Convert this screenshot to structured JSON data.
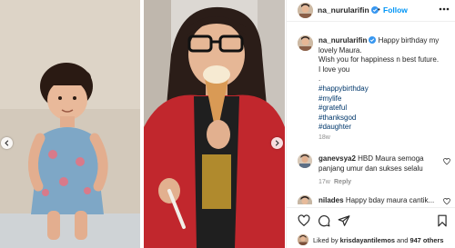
{
  "post": {
    "username": "na_nurularifin",
    "follow_label": "Follow",
    "separator": "•"
  },
  "caption": {
    "username": "na_nurularifin",
    "lines": [
      "Happy birthday my lovely Maura.",
      "Wish you for happiness n best future.",
      "I love you",
      "."
    ],
    "hashtags": [
      "#happybirthday",
      "#mylife",
      "#grateful",
      "#thanksgod",
      "#daughter"
    ],
    "time": "18w"
  },
  "comments": [
    {
      "username": "ganevsya2",
      "text": "HBD Maura semoga panjang umur dan sukses selalu",
      "time": "17w",
      "reply_label": "Reply"
    },
    {
      "username": "nilades",
      "text": "Happy bday maura cantik..."
    }
  ],
  "likes": {
    "prefix": "Liked by",
    "username": "krisdayantilemos",
    "joiner": "and",
    "others": "947 others"
  },
  "icons": {
    "verified": "verified-badge-icon",
    "more": "more-options-icon",
    "like": "heart-icon",
    "comment": "comment-icon",
    "share": "paper-plane-icon",
    "save": "bookmark-icon",
    "prev": "chevron-left-icon",
    "next": "chevron-right-icon"
  },
  "colors": {
    "accent": "#0095f6",
    "hashtag": "#00376b",
    "muted": "#8e8e8e",
    "verified": "#3897f0"
  }
}
